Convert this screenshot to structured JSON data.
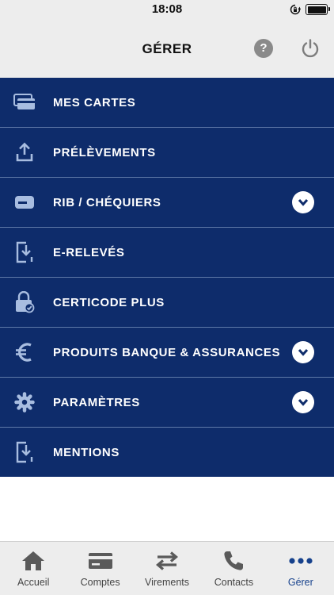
{
  "status_bar": {
    "time": "18:08"
  },
  "header": {
    "title": "GÉRER",
    "help_glyph": "?"
  },
  "menu": {
    "items": [
      {
        "label": "MES CARTES",
        "icon": "cards-icon",
        "expandable": false
      },
      {
        "label": "PRÉLÈVEMENTS",
        "icon": "upload-icon",
        "expandable": false
      },
      {
        "label": "RIB / CHÉQUIERS",
        "icon": "checkbook-icon",
        "expandable": true
      },
      {
        "label": "E-RELEVÉS",
        "icon": "document-download-icon",
        "expandable": false
      },
      {
        "label": "CERTICODE PLUS",
        "icon": "padlock-check-icon",
        "expandable": false
      },
      {
        "label": "PRODUITS BANQUE & ASSURANCES",
        "icon": "euro-icon",
        "expandable": true
      },
      {
        "label": "PARAMÈTRES",
        "icon": "gear-icon",
        "expandable": true
      },
      {
        "label": "MENTIONS",
        "icon": "document-download-icon",
        "expandable": false
      }
    ]
  },
  "tabbar": {
    "tabs": [
      {
        "label": "Accueil",
        "icon": "home-icon",
        "active": false
      },
      {
        "label": "Comptes",
        "icon": "card-icon",
        "active": false
      },
      {
        "label": "Virements",
        "icon": "transfer-arrows-icon",
        "active": false
      },
      {
        "label": "Contacts",
        "icon": "phone-icon",
        "active": false
      },
      {
        "label": "Gérer",
        "icon": "more-dots-icon",
        "active": true
      }
    ]
  },
  "colors": {
    "menu_background": "#0e2c6b",
    "menu_divider": "#5f79a8",
    "icon_light_blue": "#a8bde0",
    "header_background": "#ededed",
    "active_tab": "#16418c"
  }
}
